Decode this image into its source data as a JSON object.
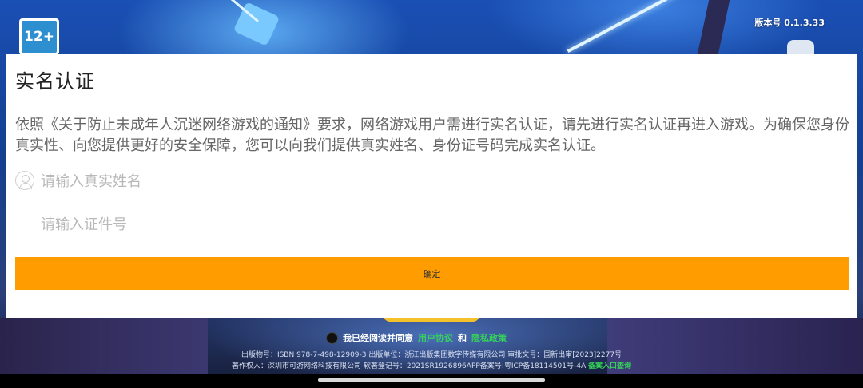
{
  "top": {
    "age_rating": "12+",
    "version": "版本号 0.1.3.33"
  },
  "dialog": {
    "title": "实名认证",
    "body": "依照《关于防止未成年人沉迷网络游戏的通知》要求，网络游戏用户需进行实名认证，请先进行实名认证再进入游戏。为确保您身份真实性、向您提供更好的安全保障，您可以向我们提供真实姓名、身份证号码完成实名认证。",
    "name_field": {
      "value": "",
      "placeholder": "请输入真实姓名"
    },
    "id_field": {
      "value": "",
      "placeholder": "请输入证件号"
    },
    "confirm_label": "确定"
  },
  "footer": {
    "agree_prefix": "我已经阅读并同意",
    "user_agreement": "用户协议",
    "and": "和",
    "privacy_policy": "隐私政策",
    "line1": "出版物号：ISBN 978-7-498-12909-3 出版单位：浙江出版集团数字传媒有限公司    审批文号：国新出审[2023]2277号",
    "line2_text": "著作权人：深圳市可游网络科技有限公司  软著登记号：2021SR1926896APP备案号:粤ICP备18114501号-4A",
    "line2_link": "备案入口查询"
  },
  "colors": {
    "accent": "#ff9c00",
    "link": "#35d25a",
    "badge_blue": "#2d8fcf"
  }
}
